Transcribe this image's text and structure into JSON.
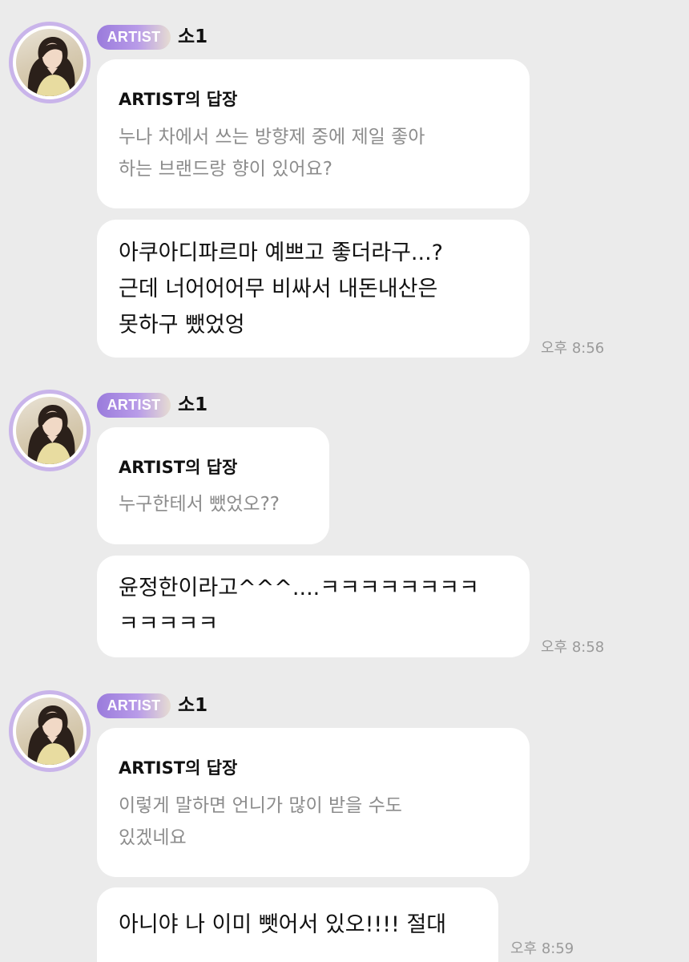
{
  "threads": [
    {
      "badge": "ARTIST",
      "name": "소1",
      "reply_title": "ARTIST의 답장",
      "reply_text": "누나 차에서 쓰는 방향제 중에 제일 좋아\n하는 브랜드랑 향이 있어요?",
      "message": "아쿠아디파르마 예쁘고 좋더라구...?\n근데 너어어어무 비싸서 내돈내산은\n못하구 뺐었엉",
      "time": "오후 8:56"
    },
    {
      "badge": "ARTIST",
      "name": "소1",
      "reply_title": "ARTIST의 답장",
      "reply_text": "누구한테서 뺐었오??",
      "message": "윤정한이라고^^^....ㅋㅋㅋㅋㅋㅋㅋㅋ\nㅋㅋㅋㅋㅋ",
      "time": "오후 8:58"
    },
    {
      "badge": "ARTIST",
      "name": "소1",
      "reply_title": "ARTIST의 답장",
      "reply_text": "이렇게 말하면 언니가 많이 받을 수도\n있겠네요",
      "message": "아니야 나 이미 뺏어서 있오!!!! 절대",
      "time": "오후 8:59"
    }
  ],
  "icons": {
    "avatar": "artist-profile-photo"
  },
  "colors": {
    "background": "#ebebeb",
    "bubble": "#ffffff",
    "badge_start": "#9a7bdc",
    "badge_end": "#e6dcd2",
    "avatar_ring": "#c9b4ea",
    "reply_text": "#8c8c8c",
    "time_text": "#9a9a9a"
  }
}
